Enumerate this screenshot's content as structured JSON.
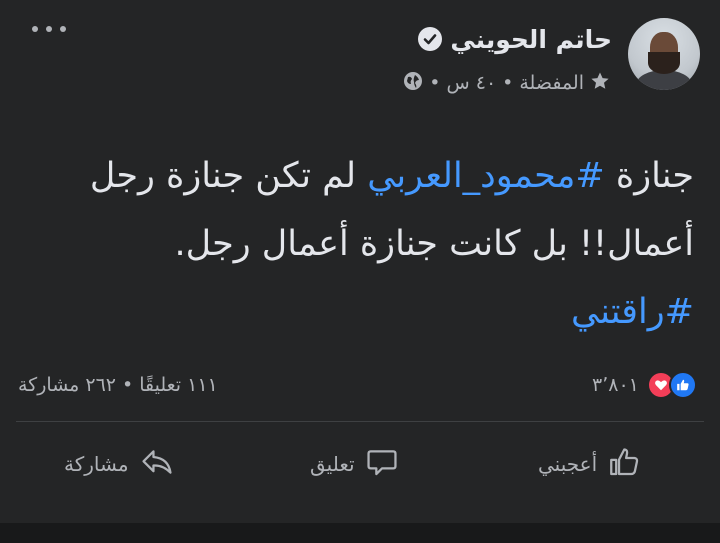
{
  "post": {
    "author": "حاتم الحويني",
    "meta": {
      "audience": "المفضلة",
      "sep1": "•",
      "time": "٤٠ س",
      "sep2": "•"
    },
    "text": {
      "l1_a": "جنازة ",
      "l1_tag": "#محمود_العربي",
      "l1_b": " لم تكن جنازة رجل",
      "l2": "أعمال!! بل كانت جنازة أعمال رجل.",
      "l3_tag": "#راقتني"
    },
    "stats": {
      "reactions": "٣٬٨٠١",
      "comments": "١١١ تعليقًا",
      "sep": "•",
      "shares": "٢٦٢ مشاركة"
    },
    "actions": {
      "like": "أعجبني",
      "comment": "تعليق",
      "share": "مشاركة"
    }
  },
  "icons": {
    "verified": "verified-badge-icon",
    "star": "star-icon",
    "globe": "globe-icon",
    "more": "more-options-icon",
    "like_reaction": "like-reaction-icon",
    "love_reaction": "love-reaction-icon",
    "like": "thumbs-up-icon",
    "comment": "comment-bubble-icon",
    "share": "share-arrow-icon"
  },
  "colors": {
    "background": "#242526",
    "text": "#e4e6eb",
    "secondary": "#b0b3b8",
    "hashtag": "#4599ff",
    "like": "#2078f4",
    "love": "#f33e58"
  }
}
